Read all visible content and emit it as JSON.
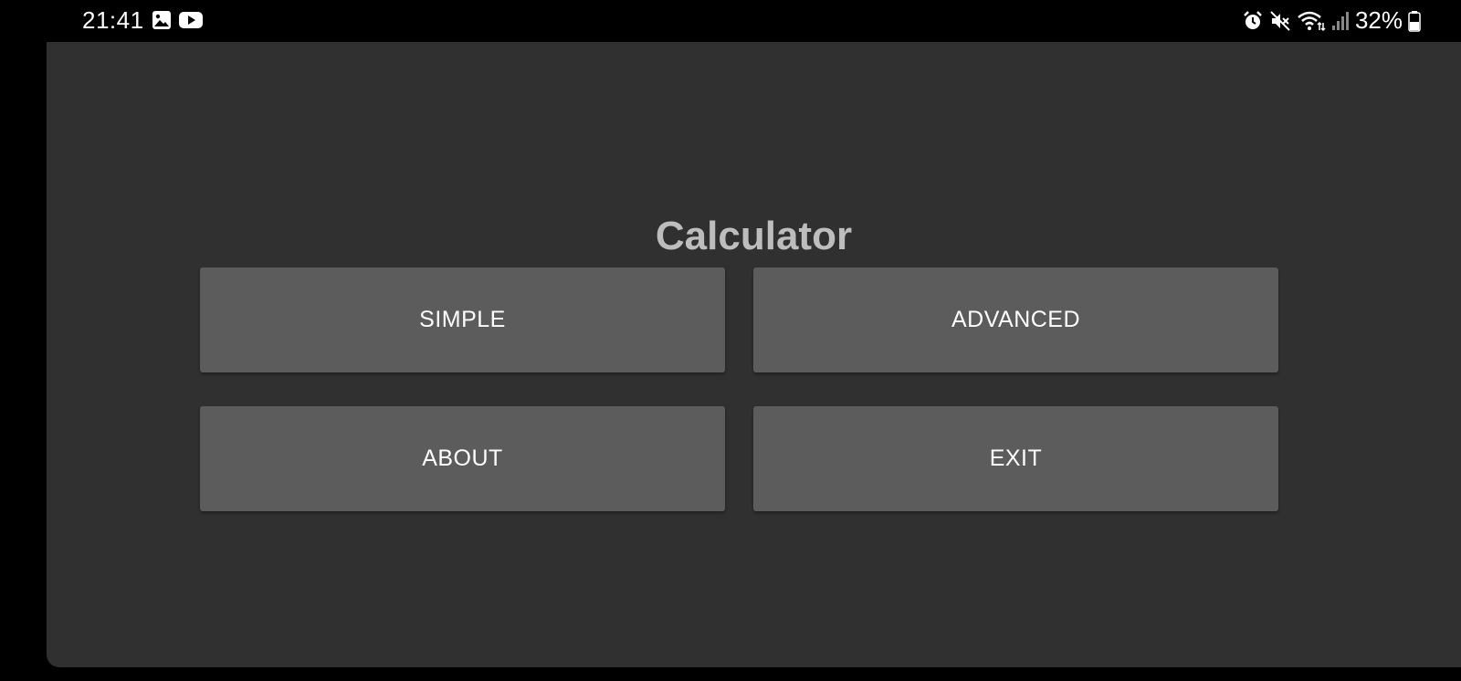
{
  "status_bar": {
    "time": "21:41",
    "battery_percent": "32%",
    "icons_left": [
      "image-icon",
      "youtube-icon"
    ],
    "icons_right": [
      "alarm-icon",
      "mute-icon",
      "wifi-icon",
      "signal-icon",
      "battery-icon"
    ]
  },
  "app": {
    "title": "Calculator",
    "buttons": {
      "simple": "SIMPLE",
      "advanced": "ADVANCED",
      "about": "ABOUT",
      "exit": "EXIT"
    }
  },
  "colors": {
    "window_bg": "#303030",
    "button_bg": "#5c5c5d",
    "title_text": "#bdbdbd",
    "button_text": "#ffffff"
  }
}
